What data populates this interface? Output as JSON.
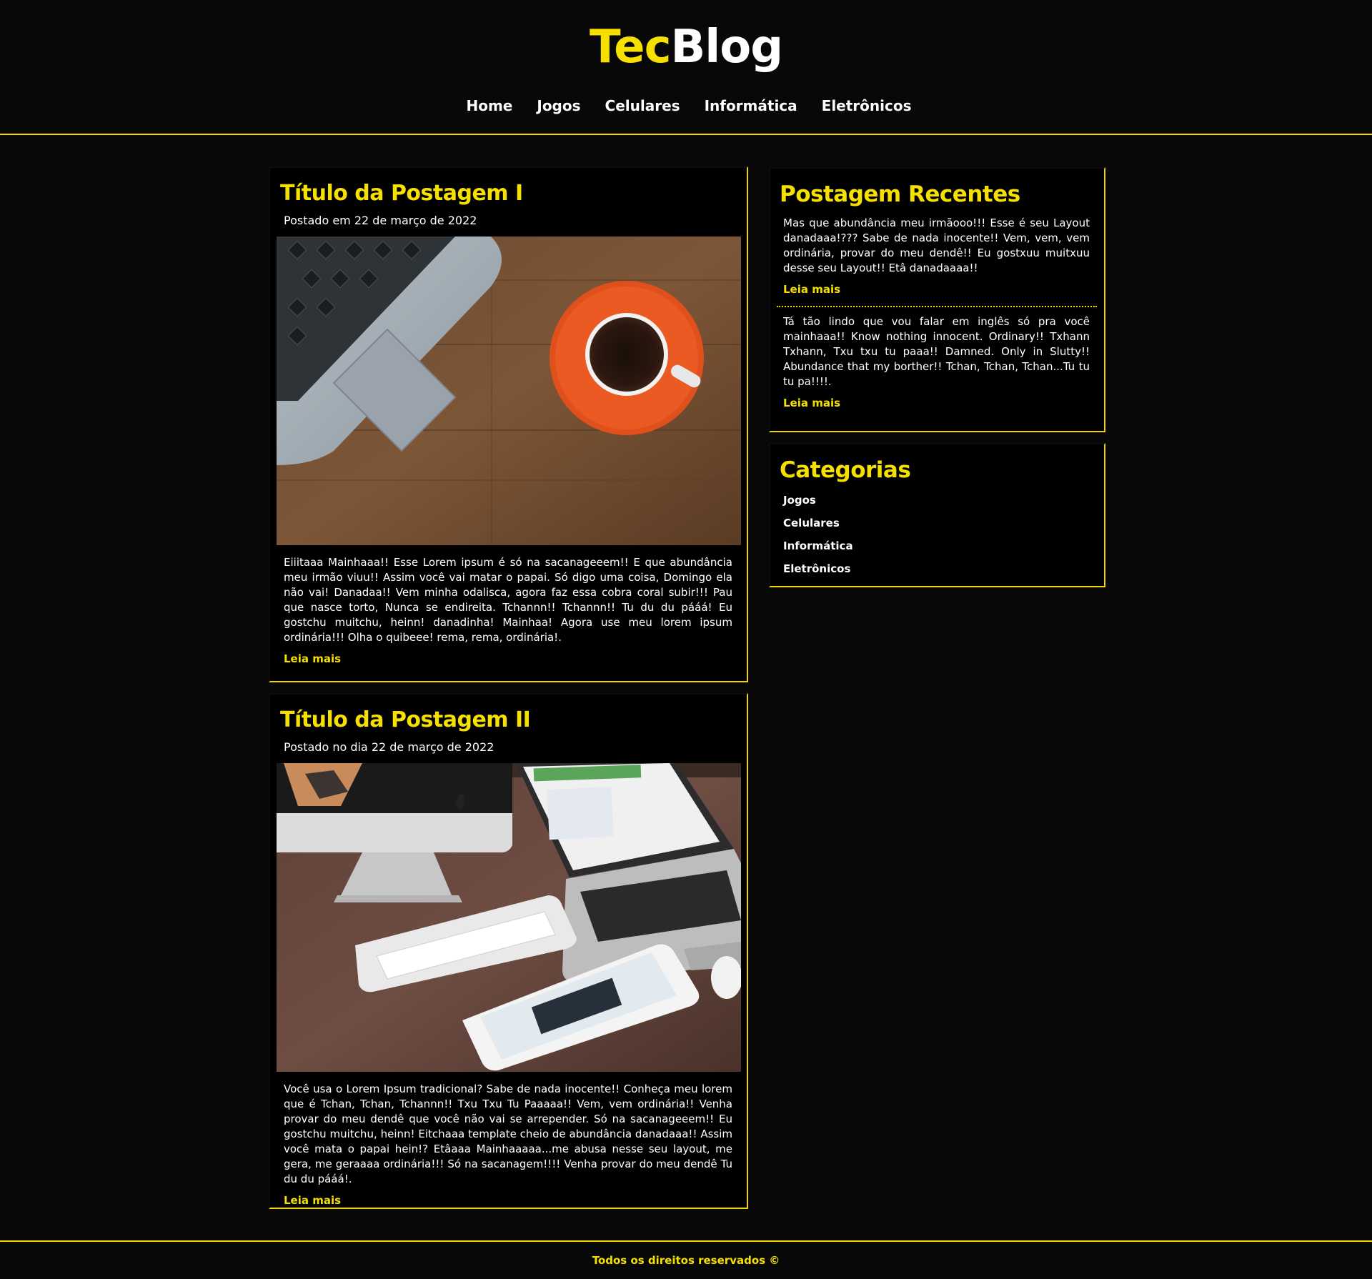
{
  "header": {
    "logo_part1": "Tec",
    "logo_part2": "Blog",
    "nav": [
      "Home",
      "Jogos",
      "Celulares",
      "Informática",
      "Eletrônicos"
    ]
  },
  "posts": [
    {
      "title": "Título da Postagem I",
      "date": "Postado em 22 de março de 2022",
      "image_icon": "laptop-coffee-photo",
      "text": "Eiiitaaa Mainhaaa!! Esse Lorem ipsum é só na sacanageeem!! E que abundância meu irmão viuu!! Assim você vai matar o papai. Só digo uma coisa, Domingo ela não vai! Danadaa!! Vem minha odalisca, agora faz essa cobra coral subir!!! Pau que nasce torto, Nunca se endireita. Tchannn!! Tchannn!! Tu du du pááá! Eu gostchu muitchu, heinn! danadinha! Mainhaa! Agora use meu lorem ipsum ordinária!!! Olha o quibeee! rema, rema, ordinária!.",
      "more": "Leia mais"
    },
    {
      "title": "Título da Postagem II",
      "date": "Postado no dia 22 de março de 2022",
      "image_icon": "desk-devices-photo",
      "text": "Você usa o Lorem Ipsum tradicional? Sabe de nada inocente!! Conheça meu lorem que é Tchan, Tchan, Tchannn!! Txu Txu Tu Paaaaa!! Vem, vem ordinária!! Venha provar do meu dendê que você não vai se arrepender. Só na sacanageeem!! Eu gostchu muitchu, heinn! Eitchaaa template cheio de abundância danadaaa!! Assim você mata o papai hein!? Etâaaa Mainhaaaaa...me abusa nesse seu layout, me gera, me geraaaa ordinária!!! Só na sacanagem!!!! Venha provar do meu dendê Tu du du pááá!.",
      "more": "Leia mais"
    }
  ],
  "recent": {
    "title": "Postagem Recentes",
    "items": [
      {
        "text": "Mas que abundância meu irmãooo!!! Esse é seu Layout danadaaa!??? Sabe de nada inocente!! Vem, vem, vem ordinária, provar do meu dendê!! Eu gostxuu muitxuu desse seu Layout!! Etâ danadaaaa!!",
        "more": "Leia mais"
      },
      {
        "text": "Tá tão lindo que vou falar em inglês só pra você mainhaaa!! Know nothing innocent. Ordinary!! Txhann Txhann, Txu txu tu paaa!! Damned. Only in Slutty!! Abundance that my borther!! Tchan, Tchan, Tchan...Tu tu tu pa!!!!.",
        "more": "Leia mais"
      }
    ]
  },
  "categories": {
    "title": "Categorias",
    "items": [
      "Jogos",
      "Celulares",
      "Informática",
      "Eletrônicos"
    ]
  },
  "footer": {
    "text": "Todos os direitos reservados ©"
  },
  "colors": {
    "accent": "#f5e000",
    "background": "#080808",
    "panel": "#000000"
  }
}
